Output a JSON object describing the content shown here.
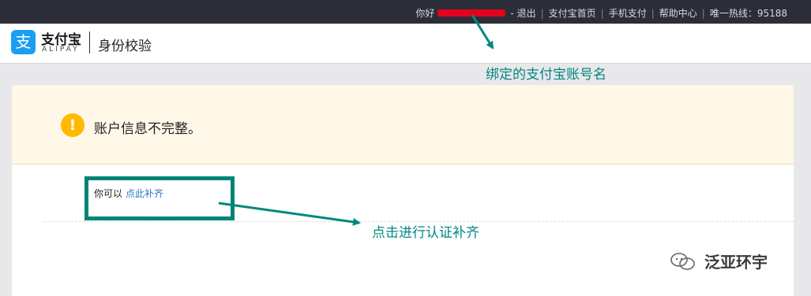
{
  "topbar": {
    "greeting": "你好",
    "links": [
      "- 退出",
      "支付宝首页",
      "手机支付",
      "帮助中心"
    ],
    "hotline": "唯一热线：95188"
  },
  "header": {
    "logo_glyph": "支",
    "logo_cn": "支付宝",
    "logo_en": "ALIPAY",
    "title": "身份校验"
  },
  "annotations": {
    "account_name": "绑定的支付宝账号名",
    "click_to_verify": "点击进行认证补齐"
  },
  "warning": {
    "icon": "!",
    "message": "账户信息不完整。"
  },
  "prompt": {
    "text": "你可以",
    "link": "点此补齐"
  },
  "watermark": {
    "text": "泛亚环宇",
    "icon": "wechat-icon"
  },
  "colors": {
    "topbar_bg": "#2b2e38",
    "alipay_blue": "#1a9ff0",
    "annotation_teal": "#00887e",
    "warning_bg": "#fff8e8",
    "warning_icon": "#ffba00",
    "redaction": "#e3001b",
    "link": "#2a79c9"
  }
}
